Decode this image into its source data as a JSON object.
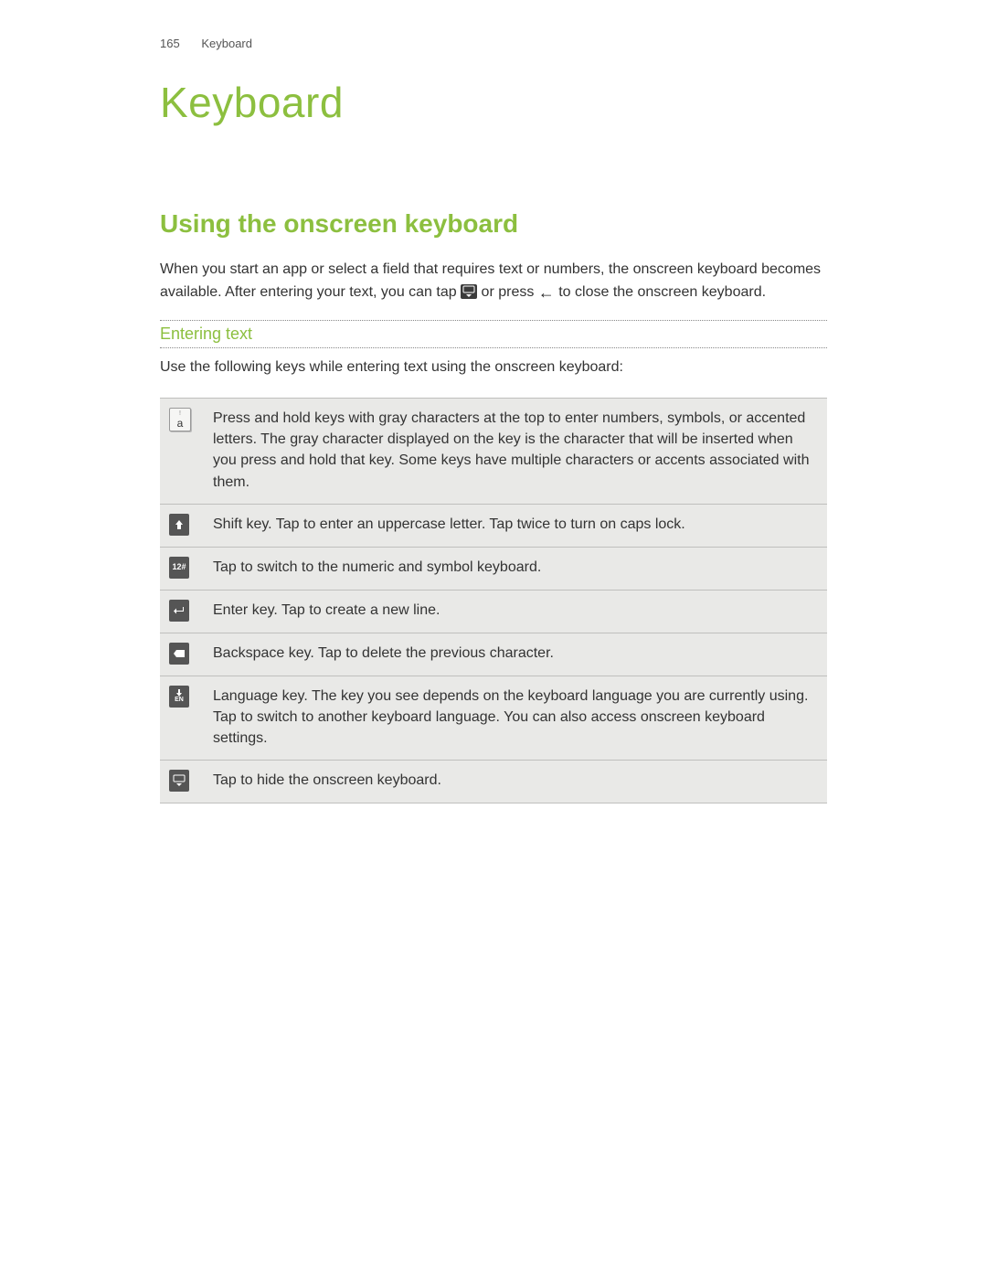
{
  "header": {
    "page_number": "165",
    "running_title": "Keyboard"
  },
  "chapter_title": "Keyboard",
  "section_title": "Using the onscreen keyboard",
  "intro_part1": "When you start an app or select a field that requires text or numbers, the onscreen keyboard becomes available. After entering your text, you can tap ",
  "intro_part2": " or press ",
  "intro_part3": " to close the onscreen keyboard.",
  "subsection_title": "Entering text",
  "lead_text": "Use the following keys while entering text using the onscreen keyboard:",
  "keys": [
    {
      "icon": "character-key",
      "desc": "Press and hold keys with gray characters at the top to enter numbers, symbols, or accented letters. The gray character displayed on the key is the character that will be inserted when you press and hold that key. Some keys have multiple characters or accents associated with them."
    },
    {
      "icon": "shift-key",
      "desc": "Shift key. Tap to enter an uppercase letter. Tap twice to turn on caps lock."
    },
    {
      "icon": "numeric-key",
      "label": "12#",
      "desc": "Tap to switch to the numeric and symbol keyboard."
    },
    {
      "icon": "enter-key",
      "desc": "Enter key. Tap to create a new line."
    },
    {
      "icon": "backspace-key",
      "desc": "Backspace key. Tap to delete the previous character."
    },
    {
      "icon": "language-key",
      "label": "EN",
      "desc": "Language key. The key you see depends on the keyboard language you are currently using. Tap to switch to another keyboard language. You can also access onscreen keyboard settings."
    },
    {
      "icon": "hide-keyboard-key",
      "desc": "Tap to hide the onscreen keyboard."
    }
  ]
}
